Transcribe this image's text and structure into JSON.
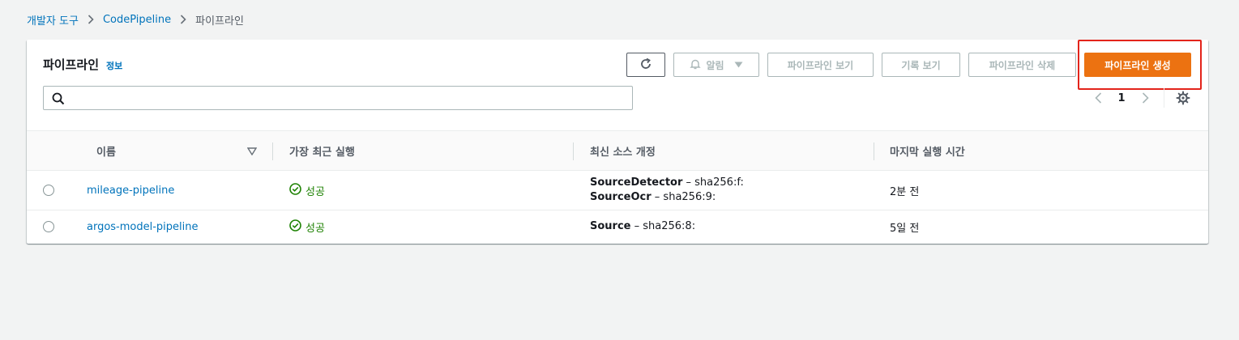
{
  "breadcrumb": {
    "items": [
      "개발자 도구",
      "CodePipeline"
    ],
    "current": "파이프라인"
  },
  "panel": {
    "title": "파이프라인",
    "info": "정보"
  },
  "toolbar": {
    "notify_label": "알림",
    "view_label": "파이프라인 보기",
    "history_label": "기록 보기",
    "delete_label": "파이프라인 삭제",
    "create_label": "파이프라인 생성"
  },
  "search": {
    "value": "",
    "placeholder": ""
  },
  "pagination": {
    "page": "1"
  },
  "table": {
    "columns": [
      "이름",
      "가장 최근 실행",
      "최신 소스 개정",
      "마지막 실행 시간"
    ],
    "rows": [
      {
        "name": "mileage-pipeline",
        "status": "성공",
        "sources": [
          {
            "name": "SourceDetector",
            "rev": "– sha256:f:"
          },
          {
            "name": "SourceOcr",
            "rev": "– sha256:9:"
          }
        ],
        "time": "2분 전"
      },
      {
        "name": "argos-model-pipeline",
        "status": "성공",
        "sources": [
          {
            "name": "Source",
            "rev": "– sha256:8:"
          }
        ],
        "time": "5일 전"
      }
    ]
  },
  "colors": {
    "link": "#0073bb",
    "success": "#1d8102",
    "primary_button": "#ec7211",
    "highlight": "#e3241b"
  },
  "icons": [
    "chevron-right-icon",
    "refresh-icon",
    "bell-icon",
    "caret-down-icon",
    "search-icon",
    "chevron-left-icon",
    "gear-icon",
    "sort-down-icon",
    "check-circle-icon"
  ]
}
